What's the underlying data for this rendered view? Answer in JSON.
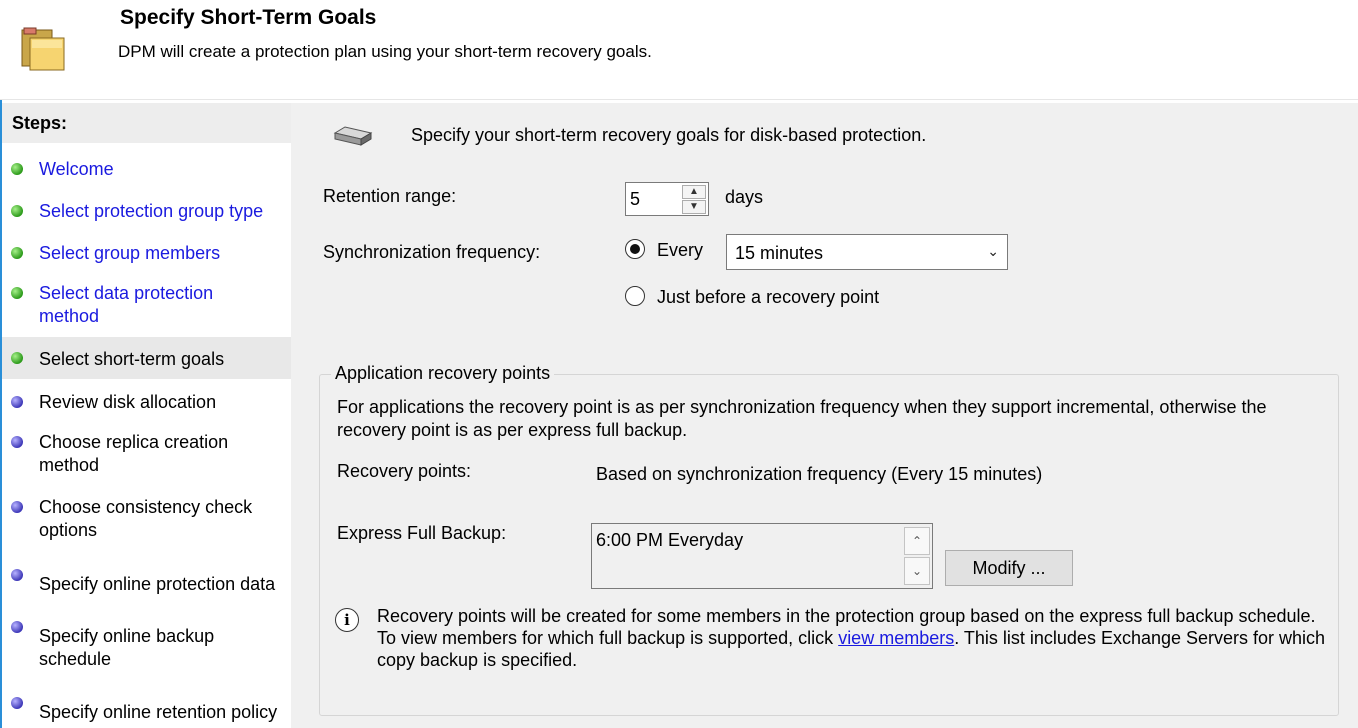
{
  "header": {
    "title": "Specify Short-Term Goals",
    "description": "DPM will create a protection plan using your short-term recovery goals.",
    "icon": "folder-icon"
  },
  "sidebar": {
    "heading": "Steps:",
    "items": [
      {
        "label": "Welcome",
        "status": "complete"
      },
      {
        "label": "Select protection group type",
        "status": "complete"
      },
      {
        "label": "Select group members",
        "status": "complete"
      },
      {
        "label": "Select data protection method",
        "status": "complete"
      },
      {
        "label": "Select short-term goals",
        "status": "current"
      },
      {
        "label": "Review disk allocation",
        "status": "pending"
      },
      {
        "label": "Choose replica creation method",
        "status": "pending"
      },
      {
        "label": "Choose consistency check options",
        "status": "pending"
      },
      {
        "label": "Specify online protection data",
        "status": "pending"
      },
      {
        "label": "Specify online backup schedule",
        "status": "pending"
      },
      {
        "label": "Specify online retention policy",
        "status": "pending"
      }
    ]
  },
  "main": {
    "intro": "Specify your short-term recovery goals for disk-based protection.",
    "retention_label": "Retention range:",
    "retention_value": "5",
    "retention_unit": "days",
    "sync_label": "Synchronization frequency:",
    "sync_every_label": "Every",
    "sync_every_selected": true,
    "sync_interval": "15 minutes",
    "sync_before_label": "Just before a recovery point",
    "sync_before_selected": false
  },
  "app_recovery": {
    "title": "Application recovery points",
    "description": "For applications the recovery point is as per synchronization frequency when they support incremental, otherwise the recovery point is as per express full backup.",
    "recovery_points_label": "Recovery points:",
    "recovery_points_value": "Based on synchronization frequency (Every 15 minutes)",
    "express_label": "Express Full Backup:",
    "express_value": "6:00 PM Everyday",
    "modify_label": "Modify ...",
    "info_text_before": "Recovery points will be created for some members in the protection group based on the express full backup schedule. To view members for which full backup is supported, click ",
    "info_link": "view members",
    "info_text_after": ". This list includes Exchange Servers for which copy backup is specified."
  },
  "colors": {
    "link": "#1a1adf",
    "step_complete": "#2c9a1a",
    "step_pending": "#3e38b8",
    "content_bg": "#f0f0f0"
  }
}
